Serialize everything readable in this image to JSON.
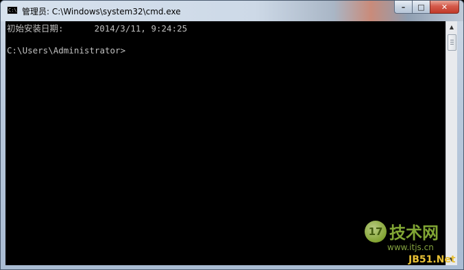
{
  "window": {
    "icon_text": "C:\\",
    "title": "管理员: C:\\Windows\\system32\\cmd.exe",
    "minimize_label": "–",
    "maximize_label": "□",
    "close_label": "✕"
  },
  "console": {
    "lines": [
      "初始安装日期:      2014/3/11, 9:24:25",
      "C:\\Users\\Administrator>"
    ]
  },
  "scrollbar": {
    "up_arrow": "▲",
    "down_arrow": "▼"
  },
  "watermark": {
    "logo_text": "17",
    "brand": "技术网",
    "url": "www.itjs.cn",
    "site": "JB51.Net"
  },
  "colors": {
    "console_background": "#000000",
    "console_text": "#c0c0c0",
    "close_button": "#c23a2a"
  }
}
